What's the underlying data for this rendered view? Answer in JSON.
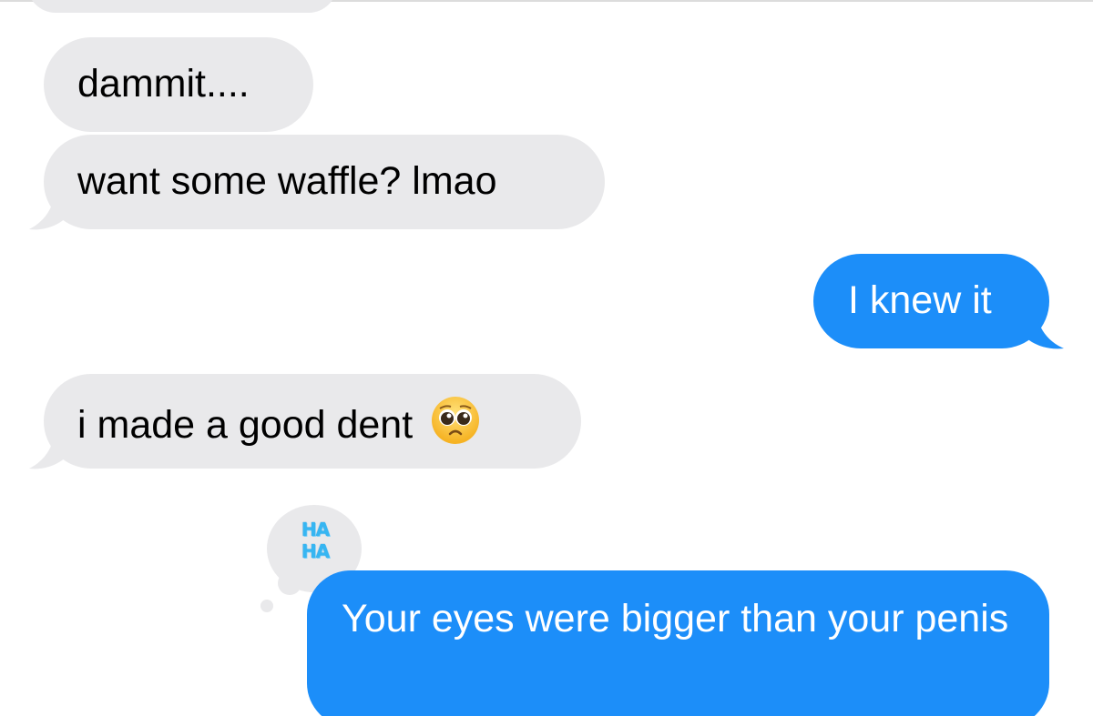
{
  "conversation": {
    "messages": [
      {
        "sender": "other",
        "text": "dammit...."
      },
      {
        "sender": "other",
        "text": "want some waffle? lmao"
      },
      {
        "sender": "me",
        "text": "I knew it"
      },
      {
        "sender": "other",
        "text": "i made a good dent",
        "emoji": "pleading-face-emoji"
      },
      {
        "sender": "me",
        "text": "Your eyes were bigger than your penis",
        "reaction": "haha-reaction"
      }
    ]
  },
  "reaction": {
    "line1": "HA",
    "line2": "HA"
  },
  "colors": {
    "incoming_bubble": "#e9e9eb",
    "outgoing_bubble": "#1c8ef9",
    "incoming_text": "#000000",
    "outgoing_text": "#ffffff",
    "reaction_text": "#36b6f2"
  }
}
